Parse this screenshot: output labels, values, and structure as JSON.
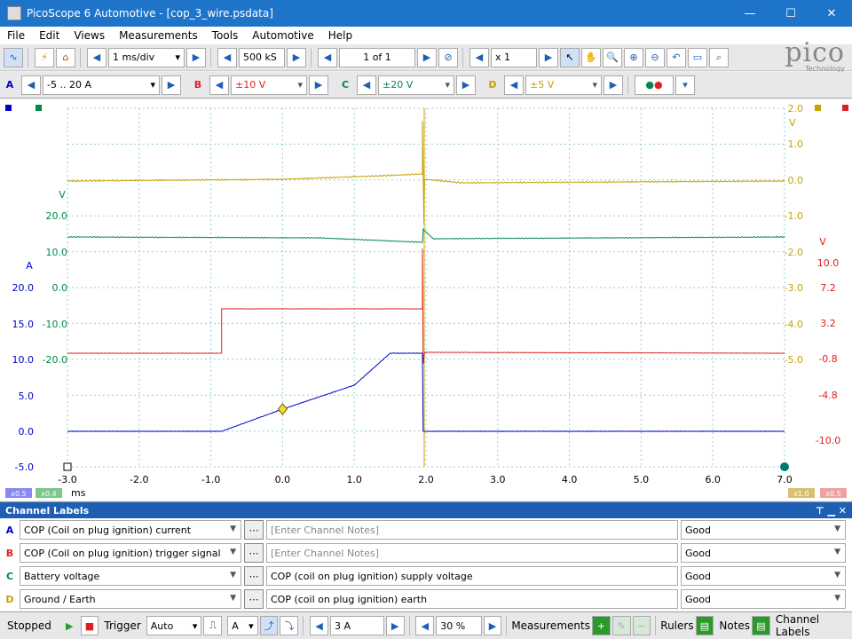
{
  "window": {
    "title": "PicoScope 6 Automotive - [cop_3_wire.psdata]",
    "minimize": "—",
    "maximize": "☐",
    "close": "✕"
  },
  "menu": [
    "File",
    "Edit",
    "Views",
    "Measurements",
    "Tools",
    "Automotive",
    "Help"
  ],
  "toolbar1": {
    "timebase": "1 ms/div",
    "samples": "500 kS",
    "buffer": "1 of 1",
    "zoom": "x 1",
    "logo": "pico",
    "logo_sub": "Technology"
  },
  "channels_bar": [
    {
      "letter": "A",
      "range": "-5 .. 20 A",
      "color": "#0000cc"
    },
    {
      "letter": "B",
      "range": "±10 V",
      "color": "#e02020"
    },
    {
      "letter": "C",
      "range": "±20 V",
      "color": "#00884a"
    },
    {
      "letter": "D",
      "range": "±5 V",
      "color": "#c8a000"
    }
  ],
  "plot": {
    "x_ticks": [
      "-3.0",
      "-2.0",
      "-1.0",
      "0.0",
      "1.0",
      "2.0",
      "3.0",
      "4.0",
      "5.0",
      "6.0",
      "7.0"
    ],
    "x_unit": "ms",
    "a_unit": "A",
    "a_ticks": [
      "20.0",
      "15.0",
      "10.0",
      "5.0",
      "0.0",
      "-5.0"
    ],
    "c_unit": "V",
    "c_ticks": [
      "20.0",
      "10.0",
      "0.0",
      "-10.0",
      "-20.0"
    ],
    "d_unit": "V",
    "d_ticks": [
      "2.0",
      "1.0",
      "0.0",
      "-1.0",
      "-2.0",
      "-3.0",
      "-4.0",
      "-5.0"
    ],
    "b_unit": "V",
    "b_ticks": [
      "10.0",
      "7.2",
      "3.2",
      "-0.8",
      "-4.8",
      "-10.0"
    ],
    "zoom_badges_left": [
      "x0.5",
      "x0.4"
    ],
    "zoom_badges_right": [
      "x1.0",
      "x0.5"
    ]
  },
  "channel_labels": {
    "header": "Channel Labels",
    "rows": [
      {
        "letter": "A",
        "label": "COP (Coil on plug ignition) current",
        "note": "[Enter Channel Notes]",
        "status": "Good",
        "color": "#0000cc"
      },
      {
        "letter": "B",
        "label": "COP (Coil on plug ignition) trigger signal",
        "note": "[Enter Channel Notes]",
        "status": "Good",
        "color": "#e02020"
      },
      {
        "letter": "C",
        "label": "Battery voltage",
        "note": "COP (coil on plug ignition) supply voltage",
        "status": "Good",
        "color": "#00884a"
      },
      {
        "letter": "D",
        "label": "Ground / Earth",
        "note": "COP (coil on plug ignition) earth",
        "status": "Good",
        "color": "#c8a000"
      }
    ]
  },
  "statusbar": {
    "state": "Stopped",
    "trigger_label": "Trigger",
    "trigger_mode": "Auto",
    "trigger_channel": "A",
    "threshold": "3 A",
    "pretrigger": "30 %",
    "measurements": "Measurements",
    "rulers": "Rulers",
    "notes": "Notes",
    "channel_labels": "Channel Labels"
  }
}
